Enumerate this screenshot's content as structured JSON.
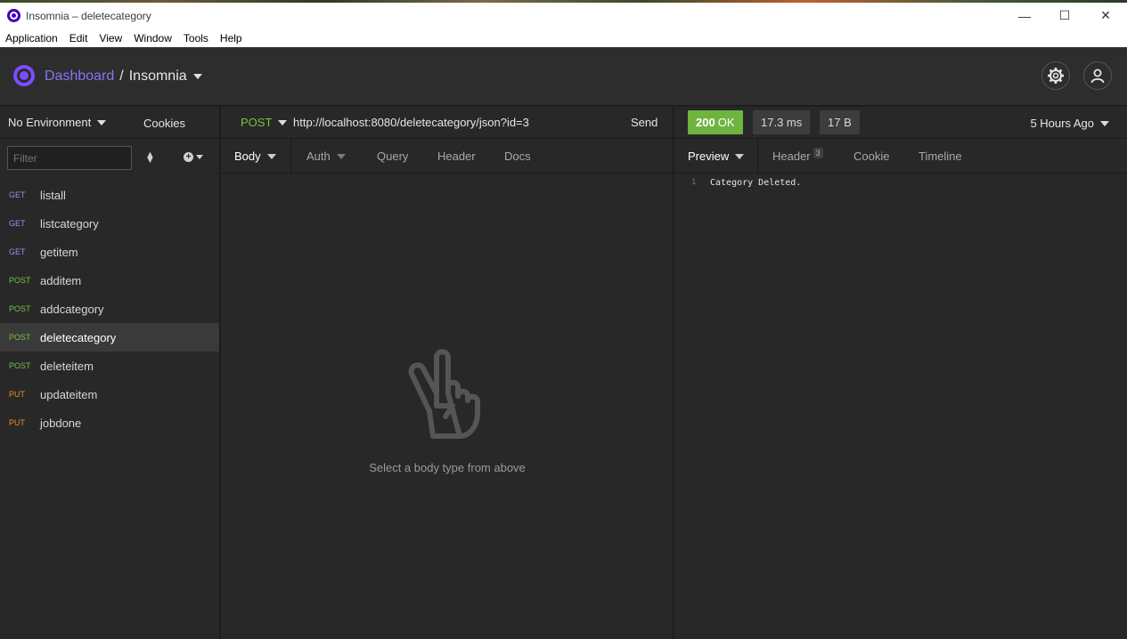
{
  "window": {
    "title": "Insomnia – deletecategory",
    "controls": {
      "minimize": "—",
      "maximize": "☐",
      "close": "✕"
    }
  },
  "menu": [
    "Application",
    "Edit",
    "View",
    "Window",
    "Tools",
    "Help"
  ],
  "header": {
    "dashboard": "Dashboard",
    "separator": "/",
    "workspace": "Insomnia",
    "settings_icon": "gear-icon",
    "account_icon": "user-icon"
  },
  "sidebar": {
    "environment": "No Environment",
    "cookies": "Cookies",
    "filter_placeholder": "Filter",
    "requests": [
      {
        "method": "GET",
        "name": "listall"
      },
      {
        "method": "GET",
        "name": "listcategory"
      },
      {
        "method": "GET",
        "name": "getitem"
      },
      {
        "method": "POST",
        "name": "additem"
      },
      {
        "method": "POST",
        "name": "addcategory"
      },
      {
        "method": "POST",
        "name": "deletecategory",
        "active": true
      },
      {
        "method": "POST",
        "name": "deleteitem"
      },
      {
        "method": "PUT",
        "name": "updateitem"
      },
      {
        "method": "PUT",
        "name": "jobdone"
      }
    ]
  },
  "request": {
    "method": "POST",
    "url": "http://localhost:8080/deletecategory/json?id=3",
    "send": "Send",
    "tabs": [
      "Body",
      "Auth",
      "Query",
      "Header",
      "Docs"
    ],
    "empty_message": "Select a body type from above"
  },
  "response": {
    "status_code": "200",
    "status_text": "OK",
    "time": "17.3 ms",
    "size": "17 B",
    "time_ago": "5 Hours Ago",
    "tabs": [
      "Preview",
      "Header",
      "Cookie",
      "Timeline"
    ],
    "header_count": "3",
    "body_lines": [
      {
        "line": "1",
        "text": "Category Deleted."
      }
    ]
  },
  "colors": {
    "accent": "#8a72f5",
    "get": "#9a8cf2",
    "post": "#77c241",
    "put": "#ee8a2e",
    "ok_badge": "#6fb43f"
  }
}
